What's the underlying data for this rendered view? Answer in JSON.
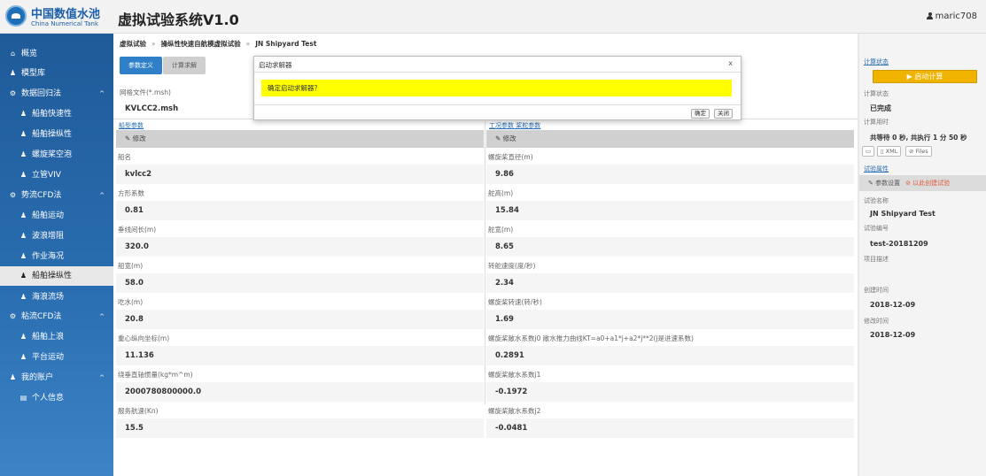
{
  "header": {
    "logo_cn": "中国数值水池",
    "logo_en": "China Numerical Tank",
    "title": "虚拟试验系统V1.0",
    "user": "maric708"
  },
  "sidebar": {
    "items": [
      {
        "label": "概览",
        "icon": "home-icon",
        "level": 1
      },
      {
        "label": "模型库",
        "icon": "user-icon",
        "level": 1
      },
      {
        "label": "数据回归法",
        "icon": "gear-icon",
        "level": 1,
        "expanded": true
      },
      {
        "label": "船舶快速性",
        "icon": "user-icon",
        "level": 2
      },
      {
        "label": "船舶操纵性",
        "icon": "user-icon",
        "level": 2
      },
      {
        "label": "螺旋桨空泡",
        "icon": "user-icon",
        "level": 2
      },
      {
        "label": "立管VIV",
        "icon": "user-icon",
        "level": 2
      },
      {
        "label": "势流CFD法",
        "icon": "gear-icon",
        "level": 1,
        "expanded": true
      },
      {
        "label": "船舶运动",
        "icon": "user-icon",
        "level": 2
      },
      {
        "label": "波浪增阻",
        "icon": "user-icon",
        "level": 2
      },
      {
        "label": "作业海况",
        "icon": "user-icon",
        "level": 2
      },
      {
        "label": "船舶操纵性",
        "icon": "user-icon",
        "level": 2,
        "active": true
      },
      {
        "label": "海浪流场",
        "icon": "user-icon",
        "level": 2
      },
      {
        "label": "粘流CFD法",
        "icon": "gear-icon",
        "level": 1,
        "expanded": true
      },
      {
        "label": "船舶上浪",
        "icon": "user-icon",
        "level": 2
      },
      {
        "label": "平台运动",
        "icon": "user-icon",
        "level": 2
      },
      {
        "label": "我的账户",
        "icon": "user-icon",
        "level": 1,
        "expanded": true
      },
      {
        "label": "个人信息",
        "icon": "id-card-icon",
        "level": 2
      }
    ]
  },
  "breadcrumb": {
    "items": [
      "虚拟试验",
      "操纵性快速自航模虚拟试验",
      "JN Shipyard Test"
    ],
    "separator": "»"
  },
  "tabs": {
    "active": "参数定义",
    "inactive": "计算求解"
  },
  "mesh_file": {
    "label": "网格文件(*.msh)",
    "value": "KVLCC2.msh"
  },
  "left_column": {
    "header": "船型参数",
    "edit_label": "修改",
    "fields": [
      {
        "label": "船名",
        "value": "kvlcc2"
      },
      {
        "label": "方形系数",
        "value": "0.81"
      },
      {
        "label": "垂线间长(m)",
        "value": "320.0"
      },
      {
        "label": "船宽(m)",
        "value": "58.0"
      },
      {
        "label": "吃水(m)",
        "value": "20.8"
      },
      {
        "label": "重心纵向坐标(m)",
        "value": "11.136"
      },
      {
        "label": "绕垂直轴惯量(kg*m^m)",
        "value": "2000780800000.0"
      },
      {
        "label": "服务航速(Kn)",
        "value": "15.5"
      }
    ]
  },
  "right_column": {
    "header": "工况参数 桨舵参数",
    "edit_label": "修改",
    "fields": [
      {
        "label": "螺旋桨直径(m)",
        "value": "9.86"
      },
      {
        "label": "舵高(m)",
        "value": "15.84"
      },
      {
        "label": "舵宽(m)",
        "value": "8.65"
      },
      {
        "label": "转舵速度(度/秒)",
        "value": "2.34"
      },
      {
        "label": "螺旋桨转速(转/秒)",
        "value": "1.69"
      },
      {
        "label": "螺旋桨敞水系数j0 敞水推力曲线KT=a0+a1*j+a2*j**2(j是进速系数)",
        "value": "0.2891"
      },
      {
        "label": "螺旋桨敞水系数j1",
        "value": "-0.1972"
      },
      {
        "label": "螺旋桨敞水系数j2",
        "value": "-0.0481"
      }
    ]
  },
  "right_panel": {
    "compute_section": "计算状态",
    "compute_button": "▶ 启动计算",
    "status_label": "计算状态",
    "status_value": "已完成",
    "time_label": "计算用时",
    "time_value": "共等待 0 秒, 共执行 1 分 50 秒",
    "btn_xml": "XML",
    "btn_files": "Files",
    "attr_section": "试验属性",
    "param_settings": "参数设置",
    "create_test": "以此创建试验",
    "test_name_label": "试验名称",
    "test_name_value": "JN Shipyard Test",
    "test_no_label": "试验编号",
    "test_no_value": "test-20181209",
    "desc_label": "项目描述",
    "created_label": "创建时间",
    "created_value": "2018-12-09",
    "modified_label": "修改时间",
    "modified_value": "2018-12-09"
  },
  "modal": {
    "title": "启动求解器",
    "close": "x",
    "message": "确定启动求解器？",
    "confirm": "确定",
    "cancel": "关闭"
  },
  "colors": {
    "sidebar": "#2a6fb2",
    "accent": "#2f80c8",
    "compute_button": "#f0b400",
    "modal_highlight": "#ffff00"
  }
}
